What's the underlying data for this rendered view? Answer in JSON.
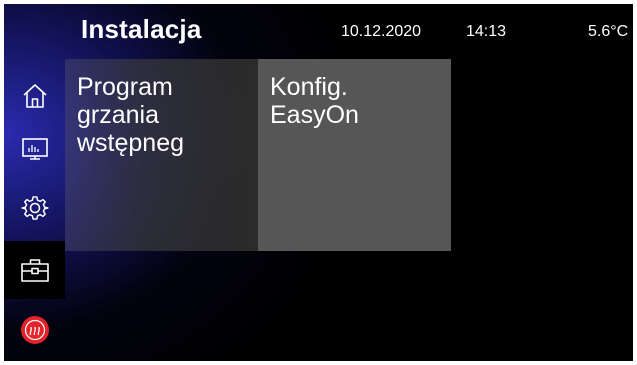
{
  "header": {
    "title": "Instalacja",
    "date": "10.12.2020",
    "time": "14:13",
    "temperature": "5.6°C"
  },
  "sidebar": {
    "items": [
      {
        "icon": "home-icon",
        "active": false
      },
      {
        "icon": "monitor-chart-icon",
        "active": false
      },
      {
        "icon": "gear-icon",
        "active": false
      },
      {
        "icon": "toolbox-icon",
        "active": true
      },
      {
        "icon": "heating-badge-icon",
        "active": false
      }
    ]
  },
  "tiles": [
    {
      "label": "Program\ngrzania\nwstępneg"
    },
    {
      "label": "Konfig.\nEasyOn"
    }
  ],
  "colors": {
    "accent_blue": "#2d2db9",
    "tile_dark": "#2d2d2d",
    "tile_gray": "#565656",
    "badge_red": "#e2232a"
  }
}
